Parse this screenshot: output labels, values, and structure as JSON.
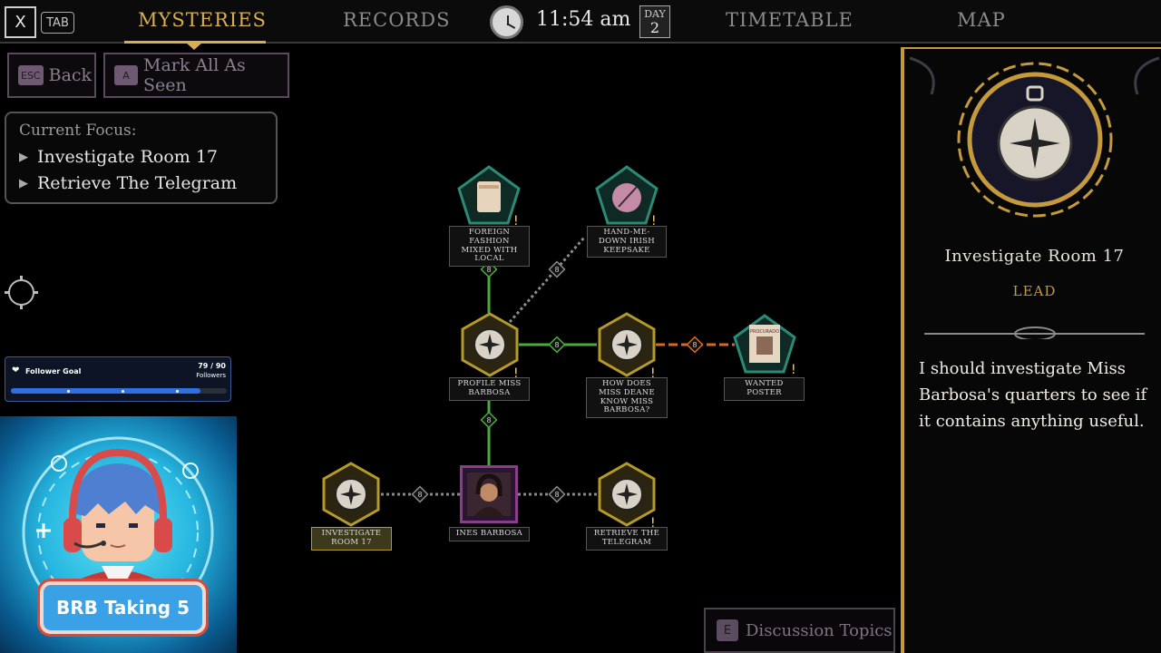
{
  "topbar": {
    "close_key": "X",
    "tab_key": "TAB",
    "tabs": [
      "MYSTERIES",
      "RECORDS",
      "TIMETABLE",
      "MAP"
    ],
    "time": "11:54 am",
    "day_label": "DAY",
    "day_number": "2"
  },
  "controls": {
    "back_key": "ESC",
    "back_label": "Back",
    "mark_key": "A",
    "mark_label": "Mark All As Seen",
    "discussion_key": "E",
    "discussion_label": "Discussion Topics"
  },
  "focus": {
    "title": "Current Focus:",
    "items": [
      "Investigate Room 17",
      "Retrieve The Telegram"
    ]
  },
  "follower_goal": {
    "label": "Follower Goal",
    "count": "79 / 90",
    "unit": "Followers",
    "progress": 0.88
  },
  "overlay": {
    "brb_text": "BRB Taking 5"
  },
  "graph": {
    "nodes": [
      {
        "id": "foreign",
        "label": "Foreign Fashion Mixed With Local",
        "kind": "record"
      },
      {
        "id": "keepsake",
        "label": "Hand-Me-Down Irish Keepsake",
        "kind": "record"
      },
      {
        "id": "profile",
        "label": "Profile Miss Barbosa",
        "kind": "lead"
      },
      {
        "id": "deane",
        "label": "How Does Miss Deane Know Miss Barbosa?",
        "kind": "lead"
      },
      {
        "id": "poster",
        "label": "Wanted Poster",
        "kind": "record"
      },
      {
        "id": "room17",
        "label": "Investigate Room 17",
        "kind": "lead"
      },
      {
        "id": "ines",
        "label": "Ines Barbosa",
        "kind": "person"
      },
      {
        "id": "telegram",
        "label": "Retrieve The Telegram",
        "kind": "lead"
      }
    ],
    "poster_text": "PROCURADO"
  },
  "detail": {
    "title": "Investigate Room 17",
    "type": "LEAD",
    "description": "I should investigate Miss Barbosa's quarters to see if it contains anything useful."
  },
  "colors": {
    "accent_gold": "#d8ae52",
    "link_green": "#4caa3e",
    "link_orange": "#d9681e",
    "link_dotted": "#8a8a8a",
    "record_teal": "#2a8a76",
    "person_purple": "#8a3d8a"
  }
}
